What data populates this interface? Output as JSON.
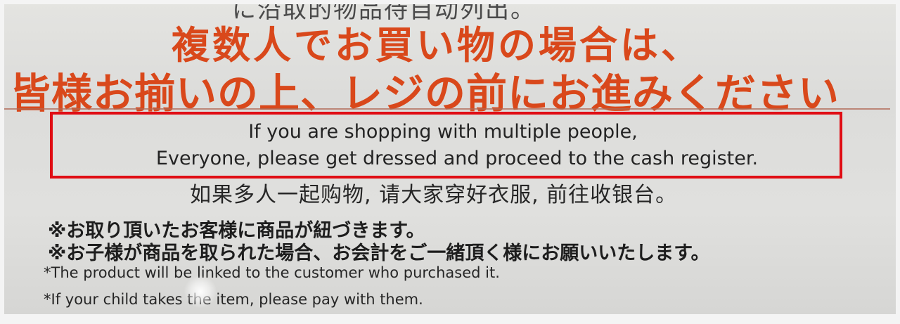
{
  "sign": {
    "cutoff_text": "に沿取的物品待自动列出。",
    "jp_title_line1": "複数人でお買い物の場合は、",
    "jp_title_line2": "皆様お揃いの上、レジの前にお進みください",
    "en_translation_line1": "If you are shopping with multiple people,",
    "en_translation_line2": "Everyone, please get dressed and proceed to the cash register.",
    "zh_translation": "如果多人一起购物, 请大家穿好衣服, 前往收银台。",
    "notes_jp": [
      "※お取り頂いたお客様に商品が紐づきます。",
      "※お子様が商品を取られた場合、お会計をご一緒頂く様にお願いいたします。"
    ],
    "notes_en": [
      "*The product will be linked to the customer who purchased it.",
      "*If your child takes the item, please pay with them."
    ]
  },
  "colors": {
    "title_red": "#d9481b",
    "highlight_box": "#e00d14",
    "text_dark": "#232323",
    "sign_background": "#dcdcda"
  }
}
